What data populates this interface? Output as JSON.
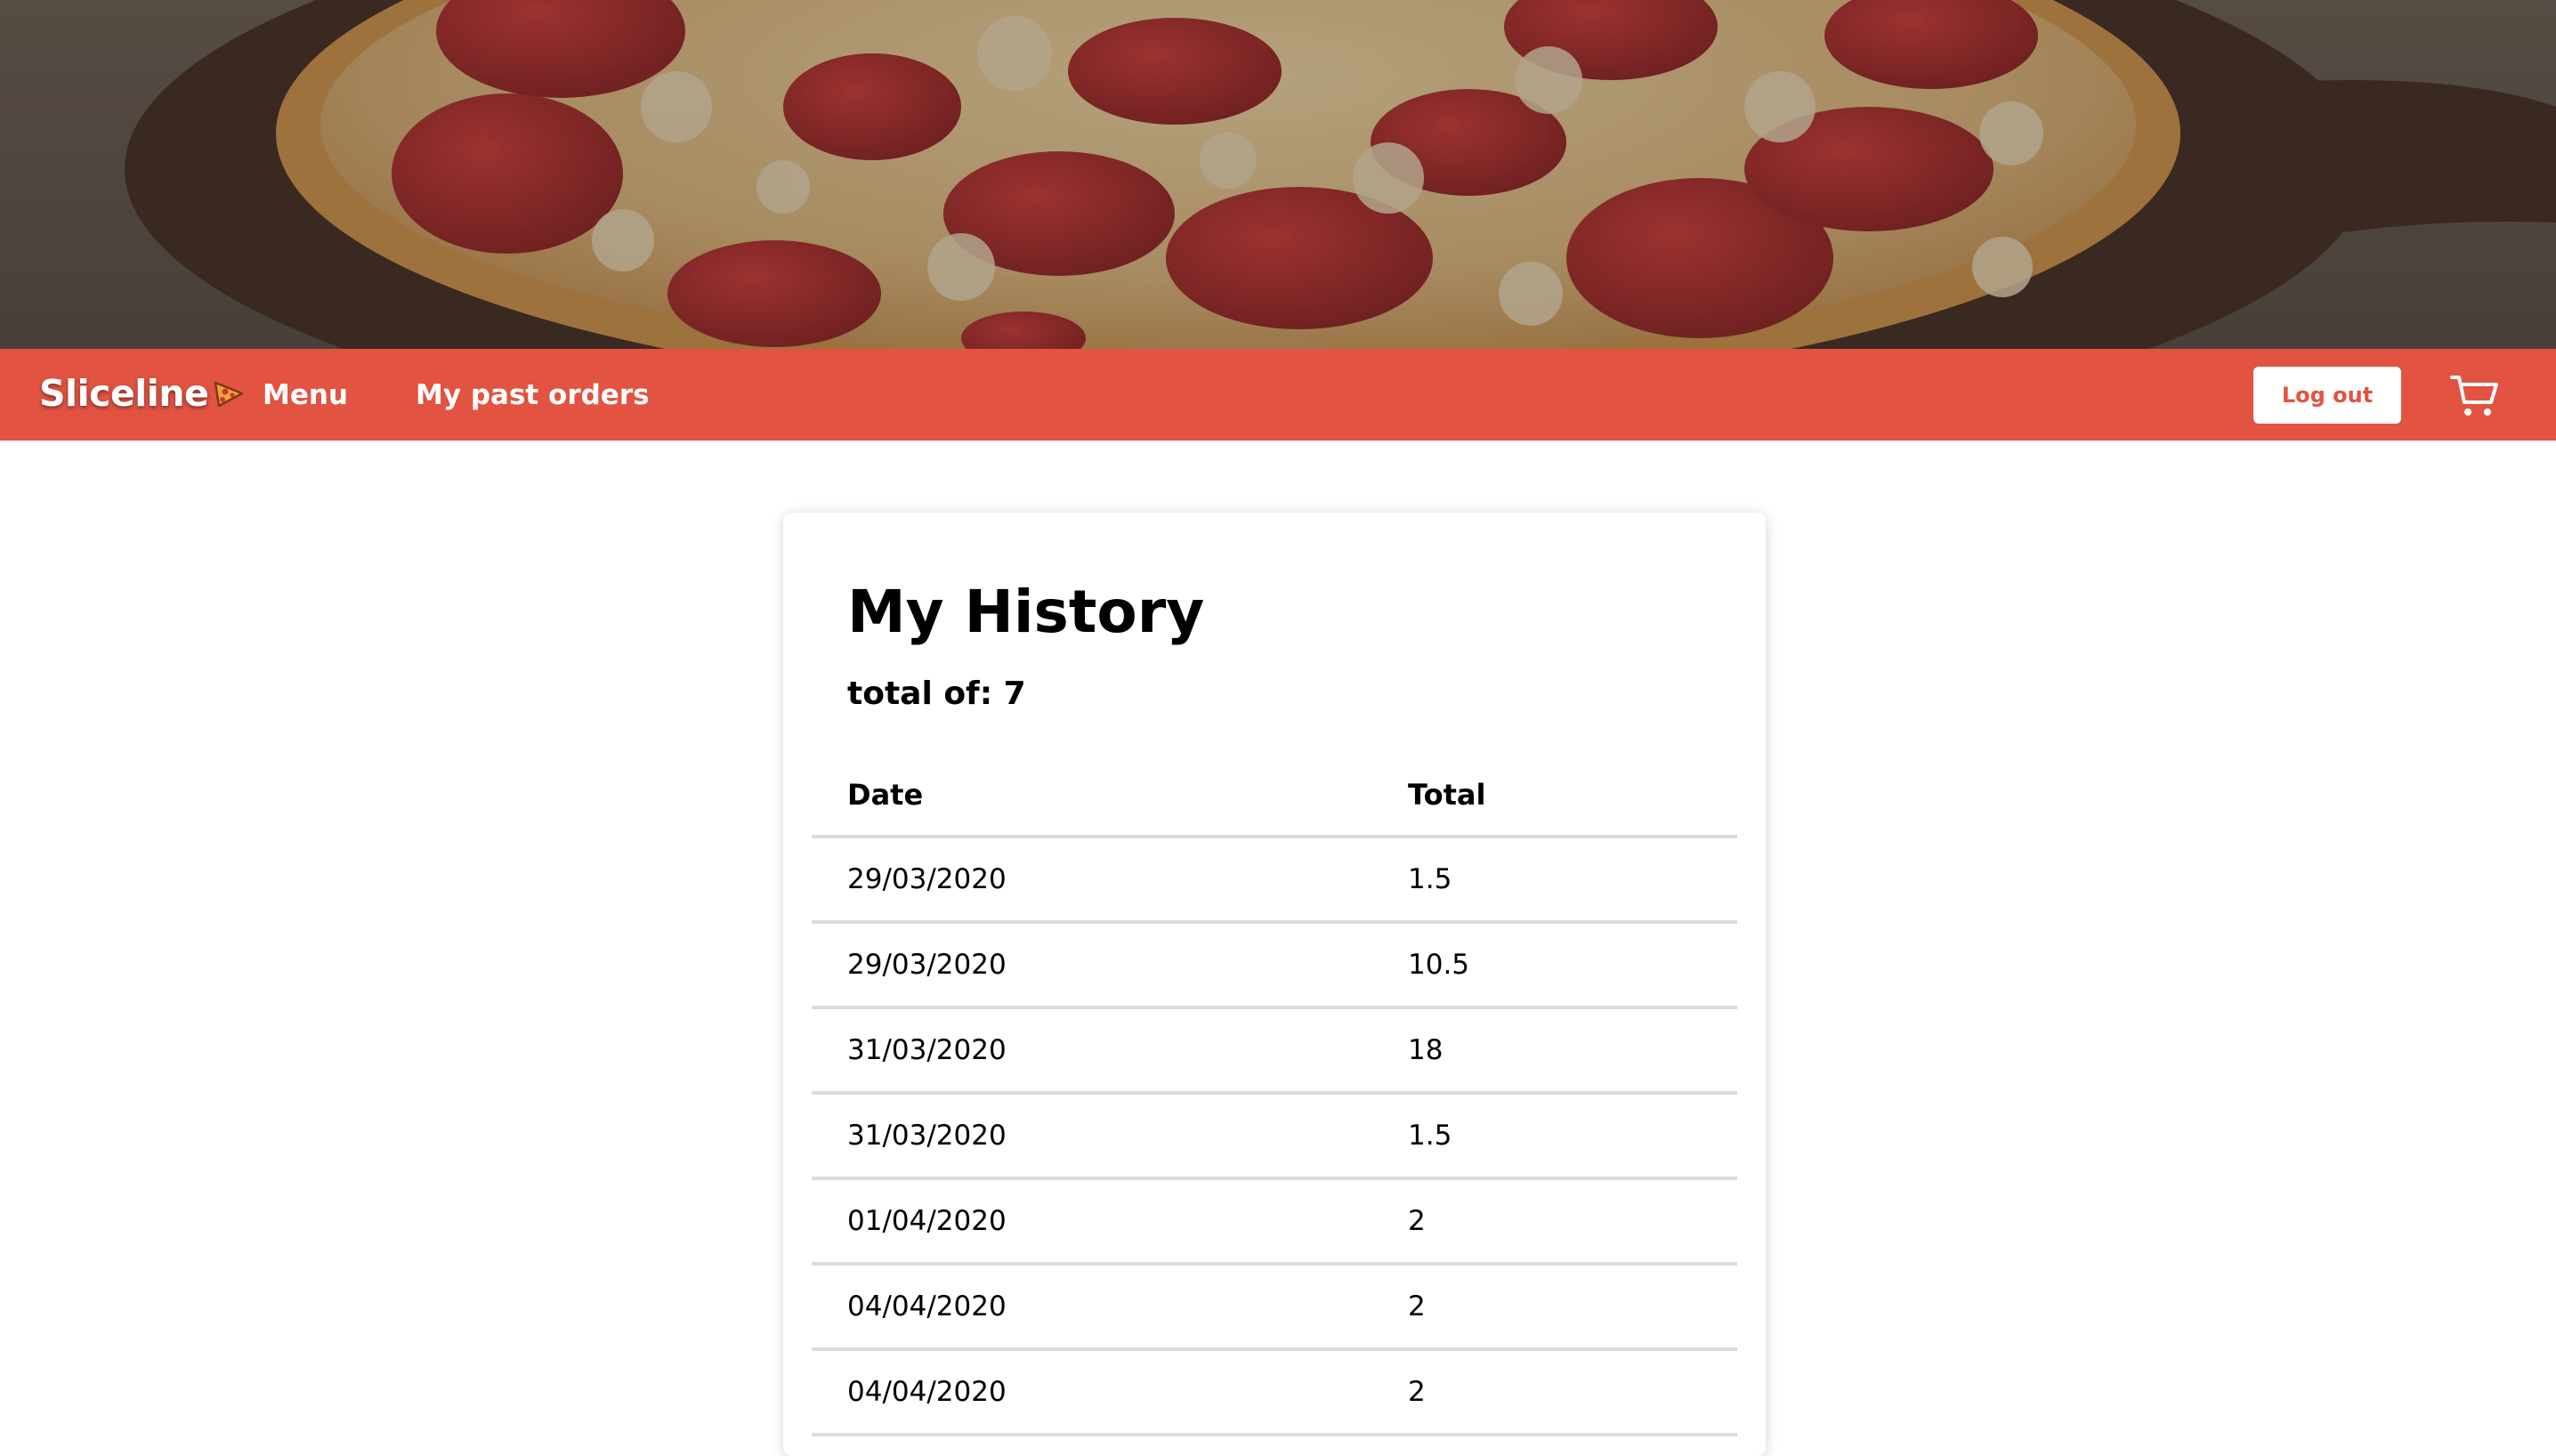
{
  "navbar": {
    "brand": "Sliceline",
    "brand_icon": "pizza-slice-icon",
    "links": [
      {
        "label": "Menu"
      },
      {
        "label": "My past orders"
      }
    ],
    "logout_label": "Log out",
    "cart_icon": "cart-icon",
    "accent_color": "#e25342"
  },
  "card": {
    "title": "My History",
    "total_label": "total of: 7",
    "columns": [
      "Date",
      "Total"
    ],
    "rows": [
      {
        "date": "29/03/2020",
        "total": "1.5"
      },
      {
        "date": "29/03/2020",
        "total": "10.5"
      },
      {
        "date": "31/03/2020",
        "total": "18"
      },
      {
        "date": "31/03/2020",
        "total": "1.5"
      },
      {
        "date": "01/04/2020",
        "total": "2"
      },
      {
        "date": "04/04/2020",
        "total": "2"
      },
      {
        "date": "04/04/2020",
        "total": "2"
      }
    ]
  }
}
